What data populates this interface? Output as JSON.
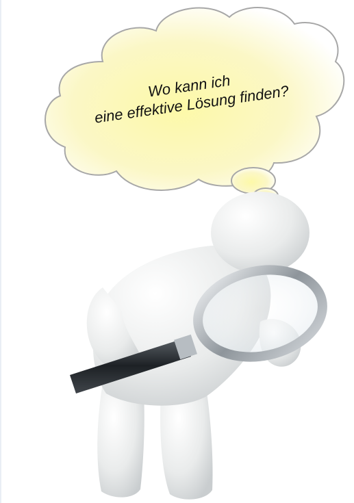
{
  "thought_bubble": {
    "line1": "Wo kann ich",
    "line2": "eine effektive Lösung finden?"
  },
  "colors": {
    "bubble_fill": "#fbf6b8",
    "bubble_stroke": "#a7a7a7",
    "figure": "#eceeee",
    "lens_rim": "#8f969c",
    "handle": "#2e3338"
  },
  "figure": {
    "icon": "searching-person-with-magnifier-icon"
  }
}
